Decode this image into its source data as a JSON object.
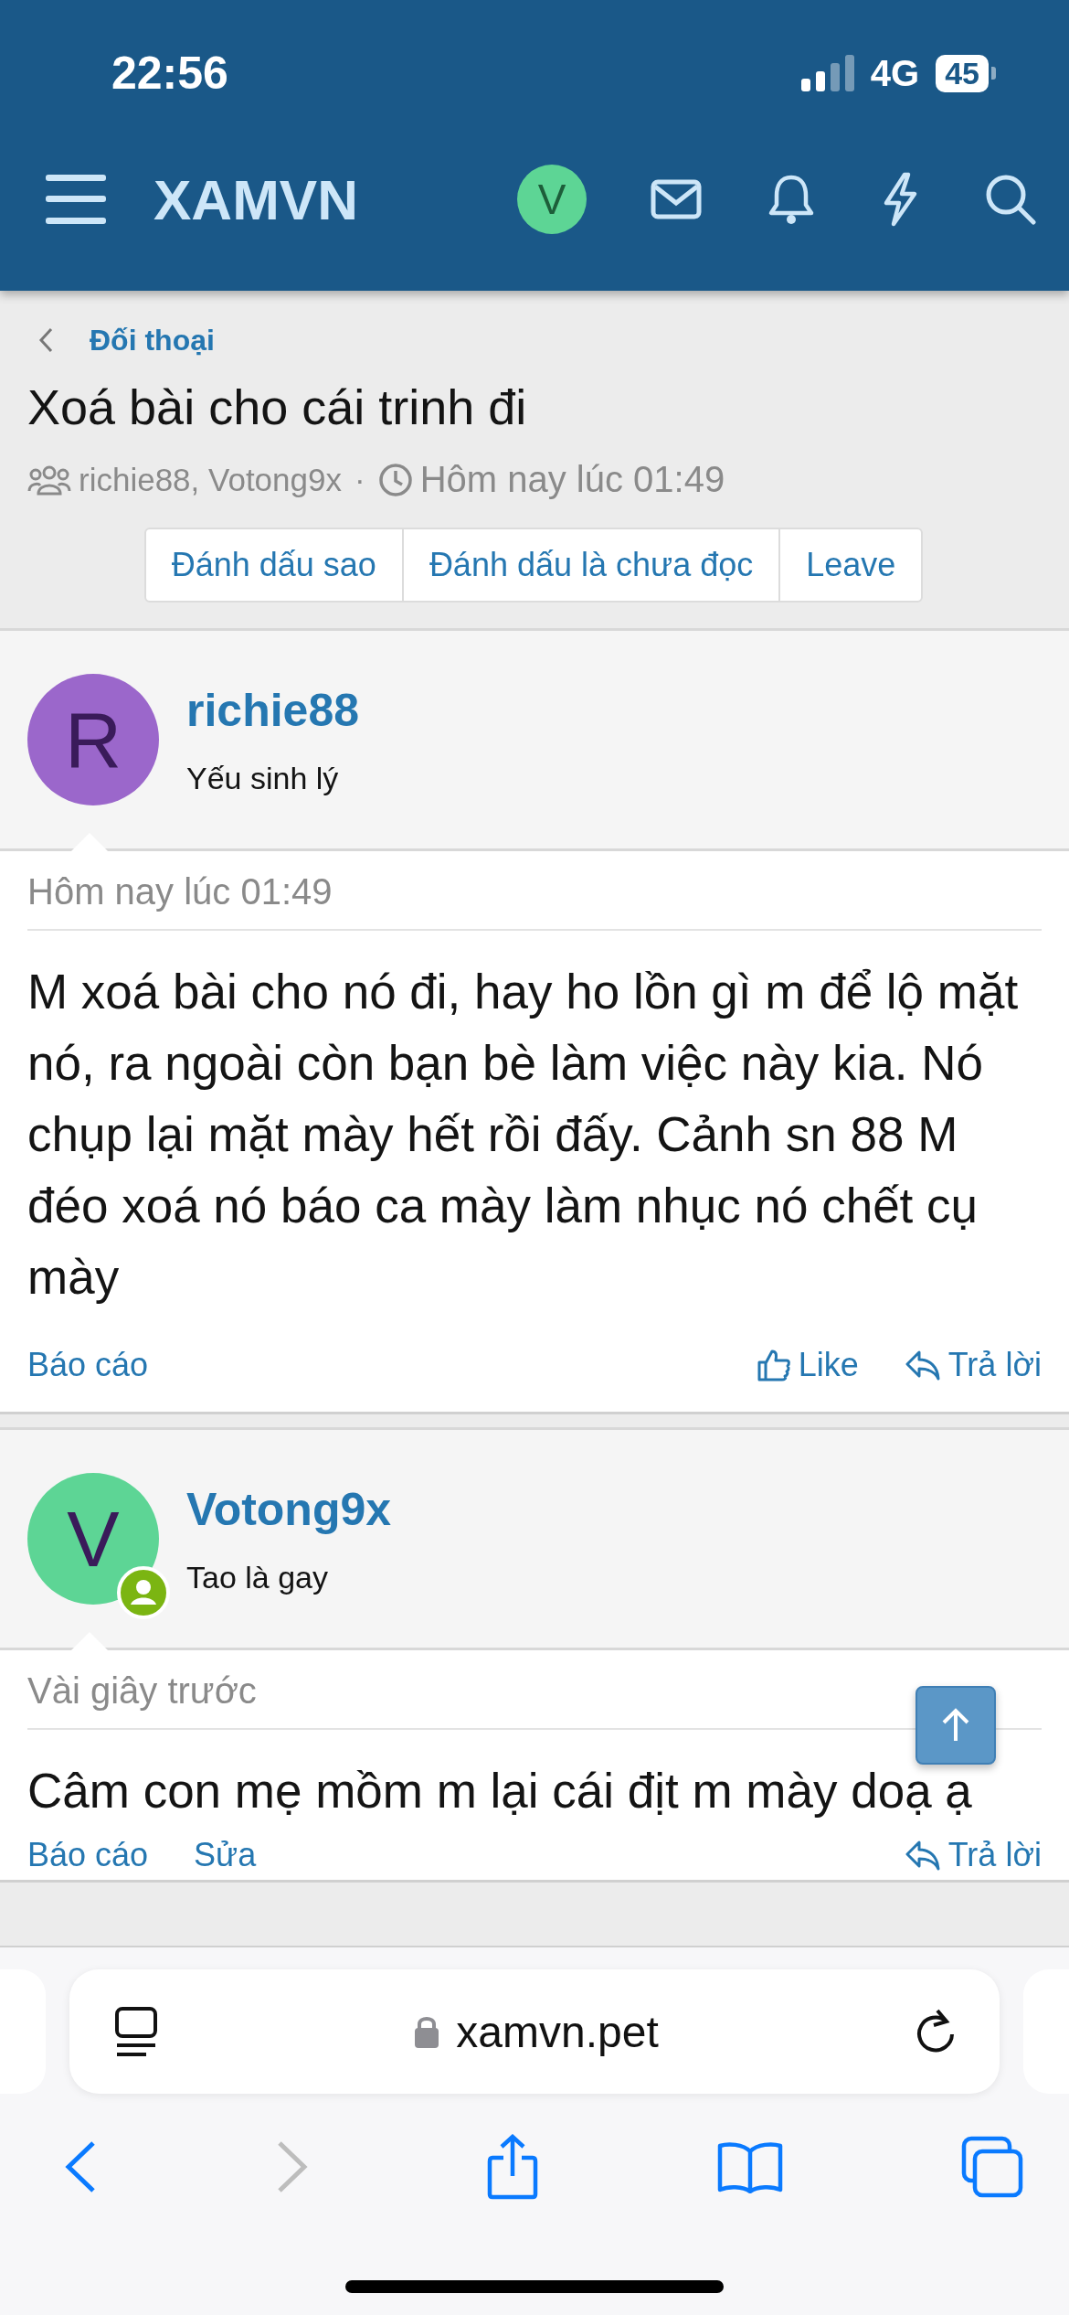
{
  "status_bar": {
    "time": "22:56",
    "network": "4G",
    "battery": "45"
  },
  "header": {
    "logo": "XAMVN",
    "avatar_letter": "V"
  },
  "breadcrumb": "Đối thoại",
  "title": "Xoá bài cho cái trinh đi",
  "meta": {
    "participants": "richie88, Votong9x",
    "separator": "·",
    "time": "Hôm nay lúc 01:49"
  },
  "actions": [
    "Đánh dấu sao",
    "Đánh dấu là chưa đọc",
    "Leave"
  ],
  "posts": [
    {
      "avatar_letter": "R",
      "color": "#9b67cb",
      "online": false,
      "username": "richie88",
      "user_title": "Yếu sinh lý",
      "time": "Hôm nay lúc 01:49",
      "message": "M xoá bài cho nó đi, hay ho lồn gì m để lộ mặt nó, ra ngoài còn bạn bè làm việc này kia. Nó chụp lại mặt mày hết rồi đấy. Cảnh sn 88 M đéo xoá nó báo ca mày làm nhục nó chết cụ mày",
      "links": [
        {
          "kind": "report",
          "label": "Báo cáo"
        },
        {
          "kind": "like",
          "label": "Like"
        },
        {
          "kind": "reply",
          "label": "Trả lời"
        }
      ]
    },
    {
      "avatar_letter": "V",
      "color": "#5dd595",
      "online": true,
      "username": "Votong9x",
      "user_title": "Tao là gay",
      "time": "Vài giây trước",
      "message": "Câm con mẹ mồm m lại cái địt m mày doạ ạ",
      "links": [
        {
          "kind": "report",
          "label": "Báo cáo"
        },
        {
          "kind": "edit",
          "label": "Sửa"
        },
        {
          "kind": "reply",
          "label": "Trả lời"
        }
      ]
    }
  ],
  "browser": {
    "url": "xamvn.pet"
  }
}
